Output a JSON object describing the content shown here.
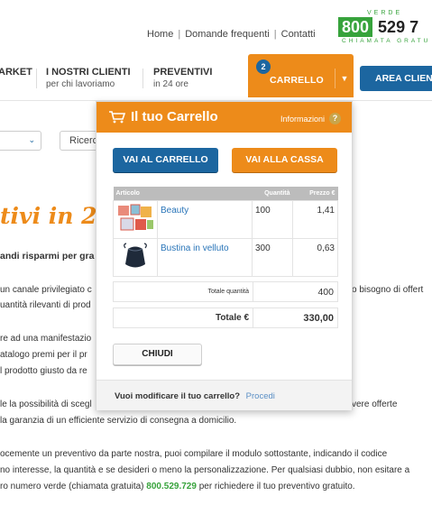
{
  "header": {
    "links": [
      "Home",
      "Domande frequenti",
      "Contatti"
    ],
    "phone": {
      "verde": "VERDE",
      "prefix": "800",
      "rest": "529 7",
      "chiamata": "CHIAMATA GRATU"
    }
  },
  "nav": {
    "items": [
      {
        "label": "ARKET",
        "sub": ""
      },
      {
        "label": "I NOSTRI CLIENTI",
        "sub": "per chi lavoriamo"
      },
      {
        "label": "PREVENTIVI",
        "sub": "in 24 ore"
      }
    ],
    "cart": {
      "badge": "2",
      "label": "CARRELLO"
    },
    "area": "AREA CLIENT"
  },
  "page": {
    "search_label": "Ricerca",
    "title": "tivi in 24",
    "lines": [
      "andi risparmi per gra",
      "un canale privilegiato c",
      "uantità rilevanti di prod",
      "re ad una manifestazio",
      "atalogo premi per il pr",
      "l prodotto giusto da re",
      "le la possibilità di scegl",
      "la garanzia di un efficiente servizio di consegna a domicilio.",
      "ocemente un preventivo da parte nostra, puoi compilare il modulo sottostante, indicando il codice",
      "no interesse, la quantità e se desideri o meno la personalizzazione. Per qualsiasi dubbio, non esitare a",
      "ro numero verde (chiamata gratuita) ",
      "800.529.729",
      " per richiedere il tuo preventivo gratuito."
    ],
    "right_snips": [
      "o bisogno di offert",
      "vere offerte"
    ]
  },
  "cart": {
    "title": "Il tuo Carrello",
    "info": "Informazioni",
    "info_icon": "?",
    "go_cart": "VAI AL CARRELLO",
    "checkout": "VAI ALLA CASSA",
    "columns": {
      "article": "Articolo",
      "qty": "Quantità",
      "price": "Prezzo €"
    },
    "items": [
      {
        "name": "Beauty",
        "qty": "100",
        "price": "1,41",
        "icon": "beauty-bag-icon"
      },
      {
        "name": "Bustina in velluto",
        "qty": "300",
        "price": "0,63",
        "icon": "velvet-pouch-icon"
      }
    ],
    "total_qty_label": "Totale quantità",
    "total_qty": "400",
    "total_label": "Totale €",
    "total": "330,00",
    "close": "CHIUDI",
    "footer_question": "Vuoi modificare il tuo carrello?",
    "footer_link": "Procedi"
  }
}
